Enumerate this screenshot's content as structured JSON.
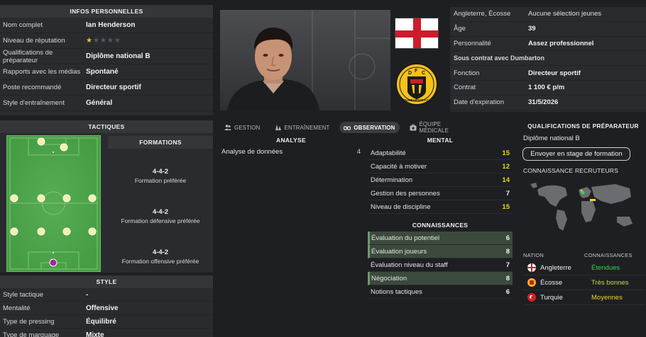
{
  "personal": {
    "header": "INFOS PERSONNELLES",
    "rows": [
      {
        "k": "Nom complet",
        "v": "Ian Henderson"
      },
      {
        "k": "Niveau de réputation",
        "v": ""
      },
      {
        "k": "Qualifications de préparateur",
        "v": "Diplôme national B"
      },
      {
        "k": "Rapports avec les médias",
        "v": "Spontané"
      },
      {
        "k": "Poste recommandé",
        "v": "Directeur sportif"
      },
      {
        "k": "Style d'entraînement",
        "v": "Général"
      }
    ],
    "reputation_stars": 1,
    "reputation_max": 5
  },
  "tactics": {
    "header": "TACTIQUES",
    "formations_header": "FORMATIONS",
    "formations": [
      {
        "name": "4-4-2",
        "desc": "Formation préférée"
      },
      {
        "name": "4-4-2",
        "desc": "Formation défensive préférée"
      },
      {
        "name": "4-4-2",
        "desc": "Formation offensive préférée"
      }
    ]
  },
  "style": {
    "header": "STYLE",
    "rows": [
      {
        "k": "Style tactique",
        "v": "-"
      },
      {
        "k": "Mentalité",
        "v": "Offensive"
      },
      {
        "k": "Type de pressing",
        "v": "Équilibré"
      },
      {
        "k": "Type de marquage",
        "v": "Mixte"
      }
    ]
  },
  "right_info": {
    "rows": [
      {
        "k": "Angleterre, Écosse",
        "v": "Aucune sélection jeunes",
        "bold": false
      },
      {
        "k": "Âge",
        "v": "39",
        "bold": true
      },
      {
        "k": "Personnalité",
        "v": "Assez professionnel",
        "bold": true
      },
      {
        "k": "Sous contrat avec Dumbarton",
        "v": "",
        "bold": true,
        "full": true
      },
      {
        "k": "Fonction",
        "v": "Directeur sportif",
        "bold": true
      },
      {
        "k": "Contrat",
        "v": "1 100 € p/m",
        "bold": true
      },
      {
        "k": "Date d'expiration",
        "v": "31/5/2026",
        "bold": true
      }
    ]
  },
  "club_badge": {
    "line1": "D  F  C",
    "line2": "DUMBARTON F.C."
  },
  "tabs": [
    {
      "label": "GESTION",
      "icon": "people-icon",
      "active": false
    },
    {
      "label": "ENTRAÎNEMENT",
      "icon": "cones-icon",
      "active": false
    },
    {
      "label": "OBSERVATION",
      "icon": "binoculars-icon",
      "active": true
    },
    {
      "label": "ÉQUIPE MÉDICALE",
      "icon": "medical-kit-icon",
      "active": false
    }
  ],
  "analyse": {
    "title": "ANALYSE",
    "rows": [
      {
        "n": "Analyse de données",
        "v": "4"
      }
    ]
  },
  "mental": {
    "title": "MENTAL",
    "rows": [
      {
        "n": "Adaptabilité",
        "v": "15",
        "c": "yellow"
      },
      {
        "n": "Capacité à motiver",
        "v": "12",
        "c": "yellow"
      },
      {
        "n": "Détermination",
        "v": "14",
        "c": "yellow"
      },
      {
        "n": "Gestion des personnes",
        "v": "7",
        "c": "white"
      },
      {
        "n": "Niveau de discipline",
        "v": "15",
        "c": "yellow"
      }
    ]
  },
  "knowledge": {
    "title": "CONNAISSANCES",
    "rows": [
      {
        "n": "Évaluation du potentiel",
        "v": "6",
        "hl": true
      },
      {
        "n": "Évaluation joueurs",
        "v": "8",
        "hl": true
      },
      {
        "n": "Évaluation niveau du staff",
        "v": "7",
        "hl": false
      },
      {
        "n": "Négociation",
        "v": "8",
        "hl": true
      },
      {
        "n": "Notions tactiques",
        "v": "6",
        "hl": false
      }
    ]
  },
  "coaching_qual": {
    "title": "QUALIFICATIONS DE PRÉPARATEUR",
    "value": "Diplôme national B",
    "button": "Envoyer en stage de formation"
  },
  "scout_knowledge": {
    "title": "CONNAISSANCE RECRUTEURS",
    "col_nation": "NATION",
    "col_knowledge": "CONNAISSANCES",
    "rows": [
      {
        "nation": "Angleterre",
        "level": "Étendues",
        "color": "#3fd14d",
        "flag": "england"
      },
      {
        "nation": "Écosse",
        "level": "Très bonnes",
        "color": "#b4e04a",
        "flag": "scotland"
      },
      {
        "nation": "Turquie",
        "level": "Moyennes",
        "color": "#e7d81f",
        "flag": "turkey"
      }
    ]
  }
}
